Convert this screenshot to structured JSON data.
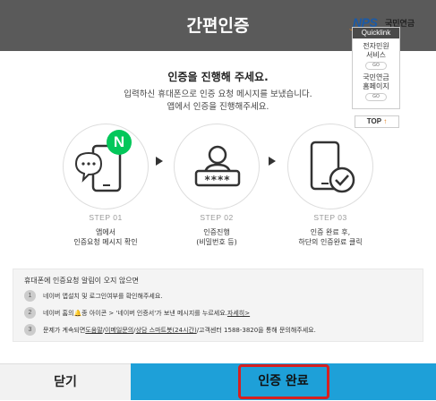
{
  "header": {
    "title": "간편인증"
  },
  "logo": {
    "nps": "NPS",
    "org": "국민연금"
  },
  "quicklink": {
    "title": "Quicklink",
    "items": [
      {
        "label_line1": "전자민원",
        "label_line2": "서비스",
        "go": "GO"
      },
      {
        "label_line1": "국민연금",
        "label_line2": "홈페이지",
        "go": "GO"
      }
    ],
    "top_label": "TOP",
    "top_arrow": "↑"
  },
  "main": {
    "title": "인증을 진행해 주세요.",
    "subtitle_line1": "입력하신 휴대폰으로 인증 요청 메시지를 보냈습니다.",
    "subtitle_line2": "앱에서 인증을 진행해주세요."
  },
  "steps": [
    {
      "label": "STEP 01",
      "desc_line1": "앱에서",
      "desc_line2": "인증요청 메시지 확인",
      "icon": "phone-chat-icon",
      "badge": "N",
      "accent": "#03c75a"
    },
    {
      "label": "STEP 02",
      "desc_line1": "인증진행",
      "desc_line2": "(비밀번호 등)",
      "icon": "user-password-icon",
      "mask": "****"
    },
    {
      "label": "STEP 03",
      "desc_line1": "인증 완료 후,",
      "desc_line2": "하단의 인증완료 클릭",
      "icon": "phone-check-icon"
    }
  ],
  "info": {
    "heading": "휴대폰에 인증요청 알림이 오지 않으면",
    "rows": [
      {
        "num": "1",
        "text": "네이버 앱설치 및 로그인여부를 확인해주세요."
      },
      {
        "num": "2",
        "pre": "네이버 홈의",
        "bell": "🔔",
        "mid": "종 아이콘 > '네이버 인증서'가 보낸 메시지를 누르세요.",
        "link": "자세히>"
      },
      {
        "num": "3",
        "pre": "문제가 계속되면 ",
        "link1": "도움말",
        "sep": "/",
        "link2": "이메일문의",
        "sep2": "/",
        "link3": "상담 스마트봇(24시간)",
        "post": "/고객센터 1588-3820을 통해 문의해주세요."
      }
    ]
  },
  "buttons": {
    "close": "닫기",
    "complete": "인증 완료"
  },
  "colors": {
    "header": "#5a5a5a",
    "complete_button": "#1ea0d8",
    "highlight": "#d62020",
    "naver_green": "#03c75a"
  }
}
